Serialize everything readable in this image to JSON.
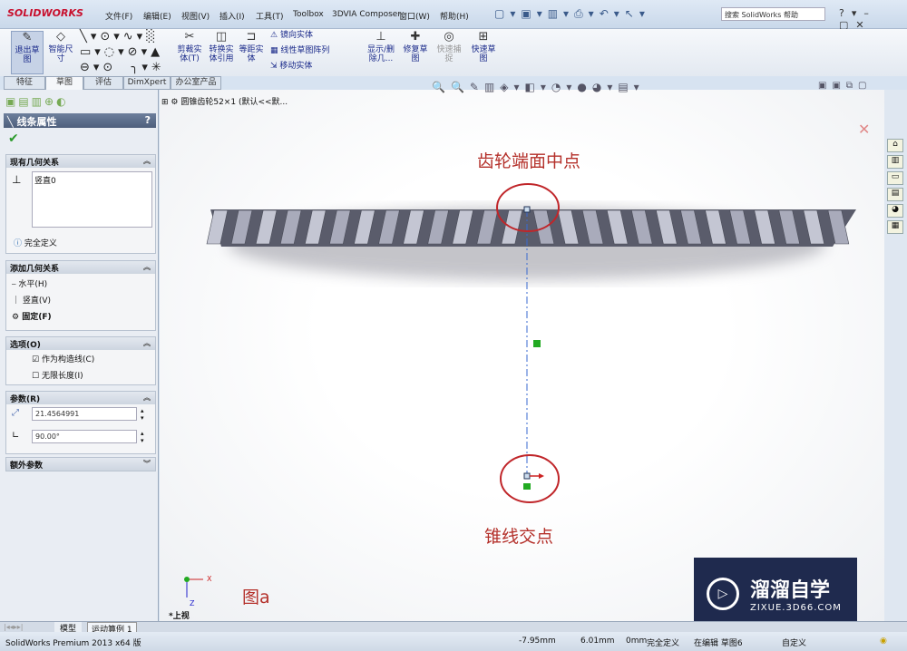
{
  "app": {
    "logo": "SOLIDWORKS",
    "search_placeholder": "搜索 SolidWorks 帮助"
  },
  "menu": [
    "文件(F)",
    "编辑(E)",
    "视图(V)",
    "插入(I)",
    "工具(T)",
    "Toolbox",
    "3DVIA Composer",
    "窗口(W)",
    "帮助(H)"
  ],
  "toolbar": {
    "exit_sketch": "退出草图",
    "smart_dim": "智能尺寸",
    "trim": "剪裁实体(T)",
    "convert": "转换实体引用",
    "offset": "等距实体",
    "mirror": "镜向实体",
    "linear_pattern": "线性草图阵列",
    "move": "移动实体",
    "show_delete": "显示/删除几...",
    "repair": "修复草图",
    "quick_snap": "快速捕捉",
    "rapid_sketch": "快速草图"
  },
  "tabs": [
    "特征",
    "草图",
    "评估",
    "DimXpert",
    "办公室产品"
  ],
  "tree": {
    "root": "圆锥齿轮52×1  (默认<<默..."
  },
  "panel": {
    "title": "线条属性",
    "help": "?",
    "existing_relations": {
      "title": "现有几何关系",
      "items": [
        "竖直0"
      ],
      "status": "完全定义"
    },
    "add_relations": {
      "title": "添加几何关系",
      "items": [
        "水平(H)",
        "竖直(V)",
        "固定(F)"
      ]
    },
    "options": {
      "title": "选项(O)",
      "construction": "作为构造线(C)",
      "construction_checked": true,
      "infinite": "无限长度(I)",
      "infinite_checked": false
    },
    "parameters": {
      "title": "参数(R)",
      "length": "21.4564991",
      "angle": "90.00°"
    },
    "extra": {
      "title": "额外参数"
    }
  },
  "viewport": {
    "annotation_top": "齿轮端面中点",
    "annotation_bottom": "锥线交点",
    "figure_label": "图a",
    "view_name": "*上视",
    "axis_x": "X",
    "axis_z": "Z"
  },
  "watermark": {
    "name": "溜溜自学",
    "url": "ZIXUE.3D66.COM"
  },
  "bottom_tabs": [
    "模型",
    "运动算例 1"
  ],
  "status": {
    "product": "SolidWorks Premium 2013 x64 版",
    "x": "-7.95mm",
    "y": "6.01mm",
    "z": "0mm",
    "defined": "完全定义",
    "editing": "在编辑 草图6",
    "custom": "自定义"
  },
  "colors": {
    "accent_red": "#b4302a",
    "watermark_bg": "#1f2a4e"
  }
}
